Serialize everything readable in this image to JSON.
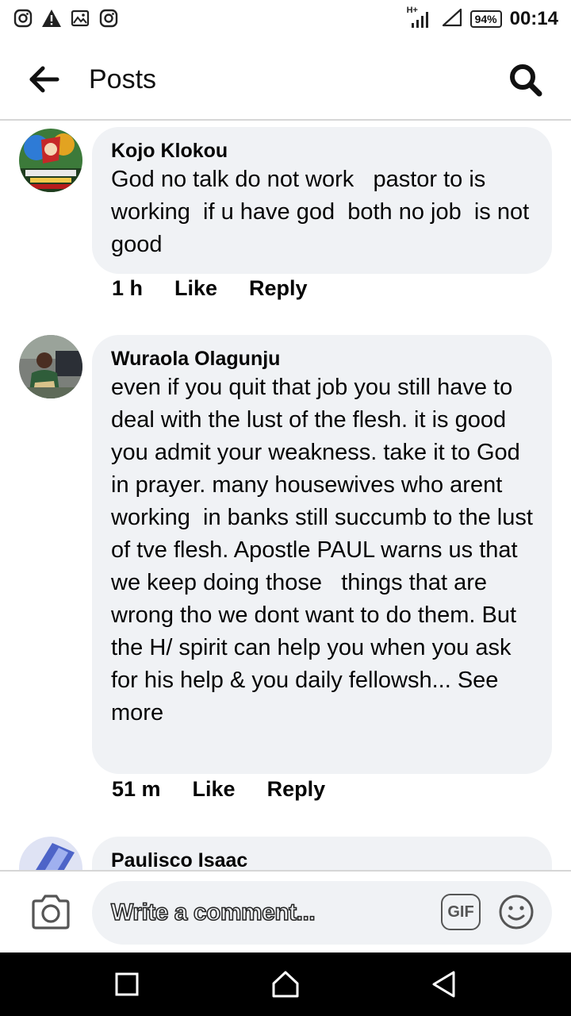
{
  "status_bar": {
    "time": "00:14",
    "battery": "94%",
    "network": "H+",
    "left_icons": [
      "instagram-icon",
      "alert-icon",
      "image-icon",
      "instagram-icon"
    ]
  },
  "header": {
    "title": "Posts"
  },
  "comments": [
    {
      "author": "Kojo Klokou",
      "text": "God no talk do not work   pastor to is working  if u have god  both no job  is not  good",
      "time": "1 h",
      "like_label": "Like",
      "reply_label": "Reply"
    },
    {
      "author": "Wuraola Olagunju",
      "text": "even if you quit that job you still have to deal with the lust of the flesh. it is good you admit your weakness. take it to God in prayer. many housewives who arent working  in banks still succumb to the lust of tve flesh. Apostle PAUL warns us that we keep doing those   things that are wrong tho we dont want to do them. But the H/ spirit can help you when you ask for his help & you daily fellowsh... ",
      "see_more": "See more",
      "time": "51 m",
      "like_label": "Like",
      "reply_label": "Reply"
    },
    {
      "author": "Paulisco Isaac"
    }
  ],
  "composer": {
    "placeholder": "Write a comment...",
    "gif_label": "GIF"
  },
  "colors": {
    "bubble": "#f0f2f5",
    "text": "#050505",
    "navbar": "#000000"
  }
}
